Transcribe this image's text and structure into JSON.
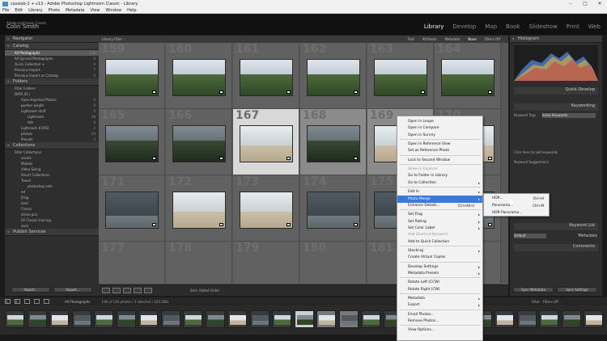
{
  "window": {
    "title": "cassiab-2 + v13 - Adobe Photoshop Lightroom Classic - Library"
  },
  "menubar": [
    "File",
    "Edit",
    "Library",
    "Photo",
    "Metadata",
    "View",
    "Window",
    "Help"
  ],
  "identity": {
    "line1": "Adobe Lightroom Classic",
    "line2": "Colin Smith"
  },
  "modules": [
    {
      "label": "Library",
      "active": true
    },
    {
      "label": "Develop"
    },
    {
      "label": "Map"
    },
    {
      "label": "Book"
    },
    {
      "label": "Slideshow"
    },
    {
      "label": "Print"
    },
    {
      "label": "Web"
    }
  ],
  "left_panel": {
    "navigator": "Navigator",
    "catalog": "Catalog",
    "catalog_items": [
      {
        "label": "All Photographs",
        "count": "136"
      },
      {
        "label": "All Synced Photographs",
        "count": "0"
      },
      {
        "label": "Quick Collection +",
        "count": "0"
      },
      {
        "label": "Previous Import",
        "count": "7"
      },
      {
        "label": "Previous Export as Catalog",
        "count": "0"
      }
    ],
    "folders": "Folders",
    "filter_folders": "Filter Folders",
    "drive": "DATA (D:)",
    "folder_items": [
      {
        "label": "Auto Imported Photos",
        "count": "0"
      },
      {
        "label": "gordon wright",
        "count": "0"
      },
      {
        "label": "Lightroom stuff",
        "count": "0"
      },
      {
        "label": "Lightroom",
        "count": "48"
      },
      {
        "label": "Hdr",
        "count": "0"
      },
      {
        "label": "Lightroom 8 DVD",
        "count": "2"
      },
      {
        "label": "photos",
        "count": "39"
      },
      {
        "label": "Presets",
        "count": "3"
      }
    ],
    "collections": "Collections",
    "filter_collections": "Filter Collections",
    "collection_items": [
      "assets",
      "Models",
      "Video Sizing",
      "Smart Collections",
      "Travel",
      "photoshop sets",
      "ed",
      "jfrog",
      "land",
      "Crosss",
      "drone pics",
      "LR Classic training",
      "sans"
    ],
    "publish": "Publish Services",
    "import_btn": "Import...",
    "export_btn": "Export..."
  },
  "filterbar": {
    "label": "Library Filter :",
    "filters": [
      "Text",
      "Attribute",
      "Metadata",
      "None"
    ],
    "active": "None",
    "preset": "Filters Off"
  },
  "grid": {
    "numbers": [
      "159",
      "160",
      "161",
      "162",
      "163",
      "164",
      "165",
      "166",
      "167",
      "168",
      "169",
      "170",
      "171",
      "172",
      "173",
      "174",
      "175",
      "176",
      "177",
      "178",
      "179",
      "180",
      "181",
      "182"
    ]
  },
  "toolbar": {
    "sort_label": "Sort: Added Order"
  },
  "right_panel": {
    "histogram": "Histogram",
    "quick_develop": "Quick Develop",
    "keywording": "Keywording",
    "keyword_tags": "Keyword Tags",
    "enter_keywords": "Enter Keywords",
    "click_add": "Click here to add keywords",
    "keyword_suggestions": "Keyword Suggestions",
    "keyword_set": "Keyword Set",
    "keyword_list": "Keyword List",
    "metadata": "Metadata",
    "default_label": "Default",
    "comments": "Comments",
    "sync_metadata": "Sync Metadata",
    "sync_settings": "Sync Settings"
  },
  "filmstrip_bar": {
    "page1": "1",
    "page2": "2",
    "source": "All Photographs",
    "stats": "136 of 136 photos / 3 selected / 165.DNG",
    "filter": "Filter :",
    "filter_value": "Filters Off"
  },
  "context_menu": {
    "items": [
      {
        "label": "Open in Loupe"
      },
      {
        "label": "Open in Compare"
      },
      {
        "label": "Open in Survey"
      },
      {
        "sep": true
      },
      {
        "label": "Open in Reference View"
      },
      {
        "label": "Set as Reference Photo"
      },
      {
        "sep": true
      },
      {
        "label": "Lock to Second Window"
      },
      {
        "sep": true
      },
      {
        "label": "Show in Explorer",
        "disabled": true
      },
      {
        "label": "Go to Folder in Library"
      },
      {
        "label": "Go to Collection",
        "submenu": true
      },
      {
        "sep": true
      },
      {
        "label": "Edit In",
        "submenu": true
      },
      {
        "label": "Photo Merge",
        "submenu": true,
        "active": true
      },
      {
        "label": "Enhance Details...",
        "shortcut": "Ctrl+Alt+I"
      },
      {
        "sep": true
      },
      {
        "label": "Set Flag",
        "submenu": true
      },
      {
        "label": "Set Rating",
        "submenu": true
      },
      {
        "label": "Set Color Label",
        "submenu": true
      },
      {
        "label": "Add Shortcut Keyword",
        "disabled": true
      },
      {
        "label": "Add to Quick Collection"
      },
      {
        "sep": true
      },
      {
        "label": "Stacking",
        "submenu": true
      },
      {
        "label": "Create Virtual Copies"
      },
      {
        "sep": true
      },
      {
        "label": "Develop Settings",
        "submenu": true
      },
      {
        "label": "Metadata Presets",
        "submenu": true
      },
      {
        "sep": true
      },
      {
        "label": "Rotate Left (CCW)"
      },
      {
        "label": "Rotate Right (CW)"
      },
      {
        "sep": true
      },
      {
        "label": "Metadata",
        "submenu": true
      },
      {
        "label": "Export",
        "submenu": true
      },
      {
        "sep": true
      },
      {
        "label": "Email Photos..."
      },
      {
        "label": "Remove Photos..."
      },
      {
        "sep": true
      },
      {
        "label": "View Options..."
      }
    ]
  },
  "submenu": {
    "items": [
      {
        "label": "HDR...",
        "shortcut": "Ctrl+H"
      },
      {
        "label": "Panorama...",
        "shortcut": "Ctrl+M"
      },
      {
        "label": "HDR Panorama..."
      }
    ]
  },
  "colors": {
    "accent": "#3b78d8",
    "panel": "#2e2e2e",
    "grid_bg": "#575757"
  }
}
